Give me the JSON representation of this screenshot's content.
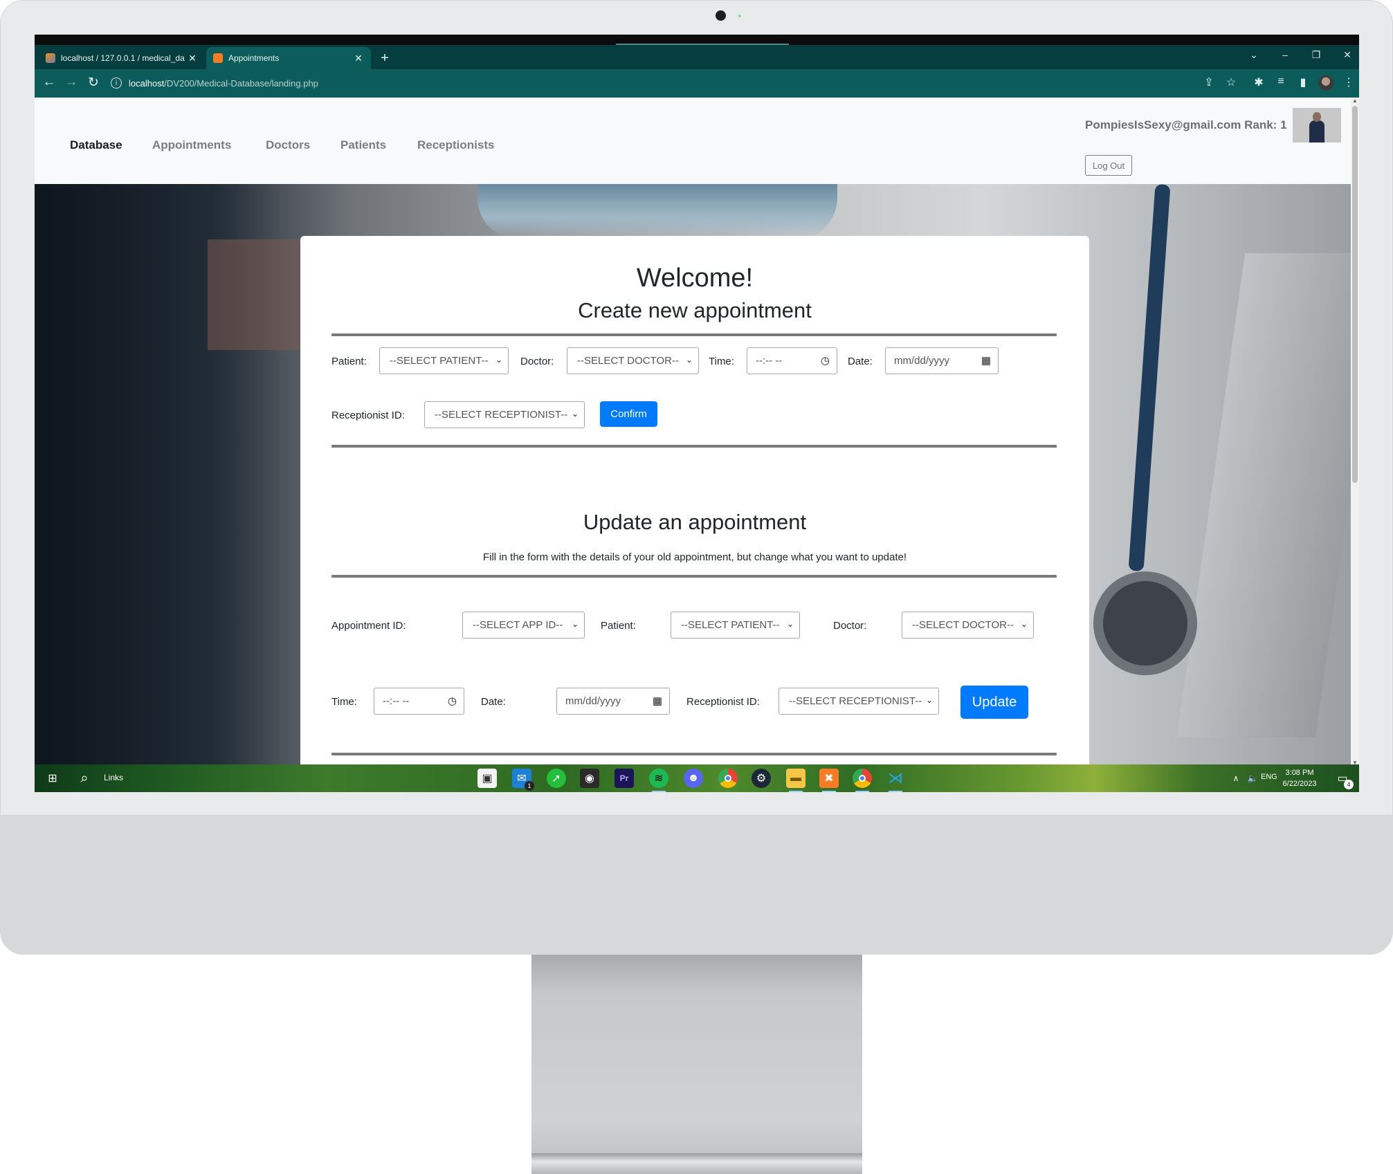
{
  "browser": {
    "tabs": [
      {
        "label": "localhost / 127.0.0.1 / medical_da",
        "active": false
      },
      {
        "label": "Appointments",
        "active": true
      }
    ],
    "url_host": "localhost",
    "url_path": "/DV200/Medical-Database/landing.php"
  },
  "nav": {
    "brand": "Database",
    "links": [
      "Appointments",
      "Doctors",
      "Patients",
      "Receptionists"
    ],
    "user_info": "PompiesIsSexy@gmail.com Rank: 1",
    "logout_label": "Log Out"
  },
  "card": {
    "welcome": "Welcome!",
    "create": {
      "title": "Create new appointment",
      "patient_label": "Patient:",
      "patient_select": "--SELECT PATIENT--",
      "doctor_label": "Doctor:",
      "doctor_select": "--SELECT DOCTOR--",
      "time_label": "Time:",
      "time_placeholder": "--:-- --",
      "date_label": "Date:",
      "date_placeholder": "mm/dd/yyyy",
      "receptionist_label": "Receptionist ID:",
      "receptionist_select": "--SELECT RECEPTIONIST--",
      "confirm_label": "Confirm"
    },
    "update": {
      "title": "Update an appointment",
      "hint": "Fill in the form with the details of your old appointment, but change what you want to update!",
      "appointment_label": "Appointment ID:",
      "appointment_select": "--SELECT APP ID--",
      "patient_label": "Patient:",
      "patient_select": "--SELECT PATIENT--",
      "doctor_label": "Doctor:",
      "doctor_select": "--SELECT DOCTOR--",
      "time_label": "Time:",
      "time_placeholder": "--:-- --",
      "date_label": "Date:",
      "date_placeholder": "mm/dd/yyyy",
      "receptionist_label": "Receptionist ID:",
      "receptionist_select": "--SELECT RECEPTIONIST--",
      "update_label": "Update"
    }
  },
  "taskbar": {
    "search_label": "Links",
    "language": "ENG",
    "time": "3:08 PM",
    "date": "6/22/2023",
    "mail_badge": "1",
    "notification_badge": "4",
    "apps": [
      "start-menu",
      "mail",
      "spotify-alt",
      "github-desktop",
      "premiere-pro",
      "spotify",
      "discord",
      "chrome",
      "steam",
      "file-explorer",
      "xampp",
      "chrome-profile",
      "vscode"
    ]
  },
  "colors": {
    "browser_frame": "#0c5c5c",
    "primary_button": "#007bff",
    "navbar_bg": "#f8f9fa"
  }
}
